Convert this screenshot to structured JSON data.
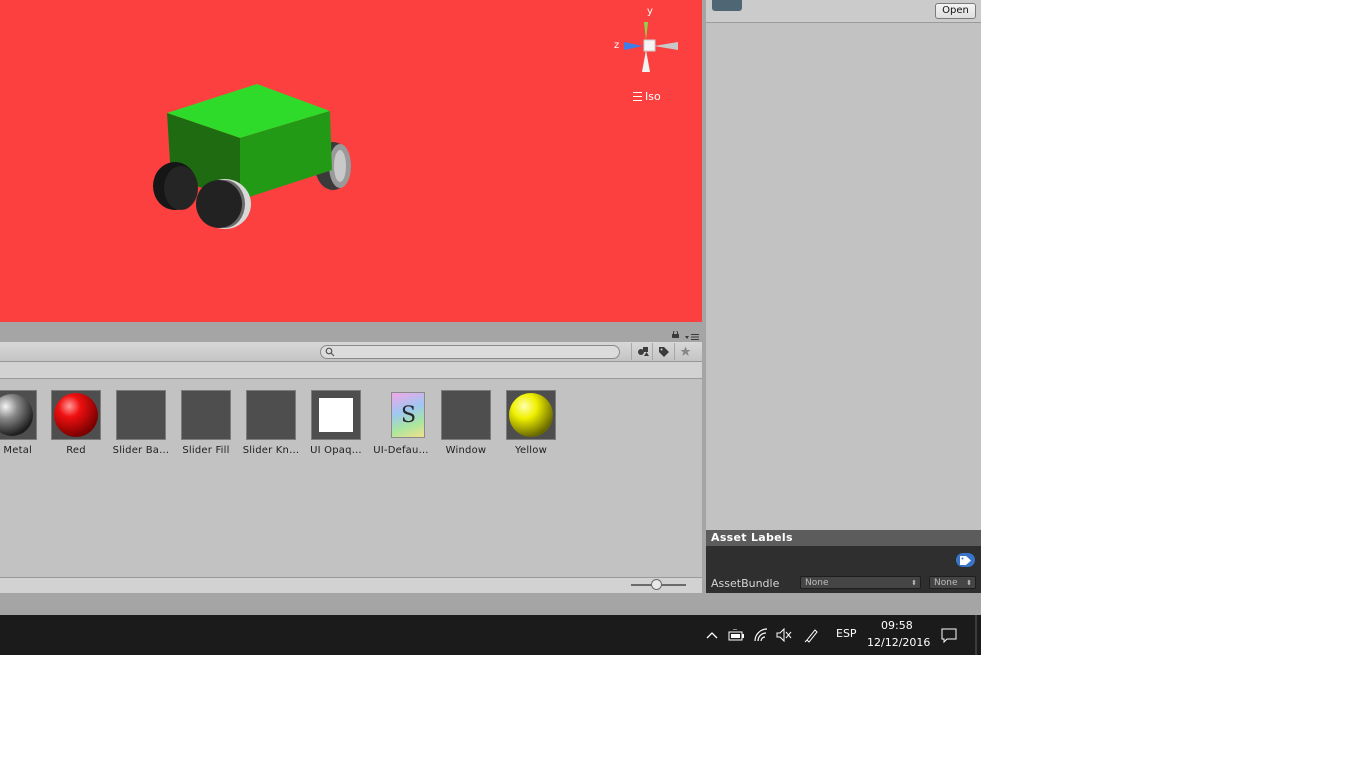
{
  "colors": {
    "scene_background": "#fc4040",
    "car_body": "#2fdb2a",
    "taskbar": "#1b1b1b",
    "asset_label_tag": "#3a74c9"
  },
  "scene": {
    "gizmo": {
      "y_label": "y",
      "z_label": "z"
    },
    "projection_label": "Iso",
    "icons": [
      "scene-gizmo-icon",
      "hamburger-icon"
    ]
  },
  "project": {
    "search": {
      "placeholder": ""
    },
    "toolbar_icons": [
      "filter-by-type-icon",
      "filter-by-label-icon",
      "favorite-star-icon"
    ],
    "assets": [
      {
        "label": "Metal",
        "kind": "metal-sphere"
      },
      {
        "label": "Red",
        "kind": "red-sphere"
      },
      {
        "label": "Slider Ba…",
        "kind": "dark-square"
      },
      {
        "label": "Slider Fill",
        "kind": "dark-square"
      },
      {
        "label": "Slider Kn…",
        "kind": "dark-square"
      },
      {
        "label": "UI Opaq…",
        "kind": "white-square"
      },
      {
        "label": "UI-Defau…",
        "kind": "shader-file"
      },
      {
        "label": "Window",
        "kind": "dark-square"
      },
      {
        "label": "Yellow",
        "kind": "yellow-sphere"
      }
    ],
    "shader_glyph": "S",
    "zoom_level": 0.45
  },
  "inspector": {
    "open_label": "Open",
    "asset_labels_title": "Asset Labels",
    "assetbundle_label": "AssetBundle",
    "assetbundle_value": "None",
    "variant_value": "None"
  },
  "taskbar": {
    "language": "ESP",
    "time": "09:58",
    "date": "12/12/2016",
    "tray_icons": [
      "chevron-up-icon",
      "battery-icon",
      "wifi-icon",
      "volume-muted-icon",
      "pen-icon",
      "notification-icon"
    ]
  }
}
